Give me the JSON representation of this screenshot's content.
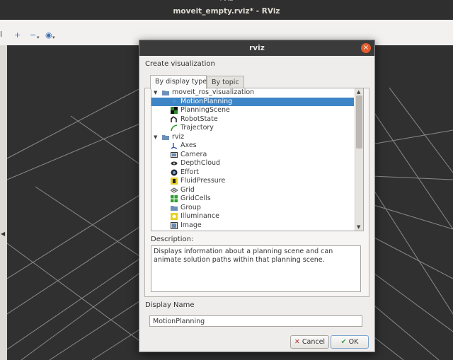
{
  "window": {
    "title": "moveit_empty.rviz* - RViz",
    "top_stub": "rviz"
  },
  "toolbar": {
    "left_sliver": "l",
    "buttons": [
      {
        "name": "add-tool",
        "glyph": "+"
      },
      {
        "name": "remove-tool",
        "glyph": "−"
      },
      {
        "name": "view-tool",
        "glyph": "◉"
      }
    ]
  },
  "dialog": {
    "title": "rviz",
    "close_glyph": "×",
    "create_label": "Create visualization",
    "tabs": [
      "By display type",
      "By topic"
    ],
    "tree": [
      {
        "type": "group",
        "label": "moveit_ros_visualization",
        "expanded": true,
        "icon": "folder-icon"
      },
      {
        "type": "item",
        "label": "MotionPlanning",
        "selected": true,
        "icon": "motion-planning-icon"
      },
      {
        "type": "item",
        "label": "PlanningScene",
        "icon": "planning-scene-icon"
      },
      {
        "type": "item",
        "label": "RobotState",
        "icon": "robot-state-icon"
      },
      {
        "type": "item",
        "label": "Trajectory",
        "icon": "trajectory-icon"
      },
      {
        "type": "group",
        "label": "rviz",
        "expanded": true,
        "icon": "folder-icon"
      },
      {
        "type": "item",
        "label": "Axes",
        "icon": "axes-icon"
      },
      {
        "type": "item",
        "label": "Camera",
        "icon": "camera-icon"
      },
      {
        "type": "item",
        "label": "DepthCloud",
        "icon": "depth-cloud-icon"
      },
      {
        "type": "item",
        "label": "Effort",
        "icon": "effort-icon"
      },
      {
        "type": "item",
        "label": "FluidPressure",
        "icon": "fluid-pressure-icon"
      },
      {
        "type": "item",
        "label": "Grid",
        "icon": "grid-icon"
      },
      {
        "type": "item",
        "label": "GridCells",
        "icon": "grid-cells-icon"
      },
      {
        "type": "item",
        "label": "Group",
        "icon": "group-icon"
      },
      {
        "type": "item",
        "label": "Illuminance",
        "icon": "illuminance-icon"
      },
      {
        "type": "item",
        "label": "Image",
        "icon": "image-icon"
      }
    ],
    "description_label": "Description:",
    "description_text": "Displays information about a planning scene and can animate solution paths within that planning scene.",
    "display_name_label": "Display Name",
    "display_name_value": "MotionPlanning",
    "cancel_label": "Cancel",
    "ok_label": "OK"
  },
  "colors": {
    "selection": "#3d85c6",
    "close": "#e45c2c",
    "folder": "#6d8fb8"
  }
}
